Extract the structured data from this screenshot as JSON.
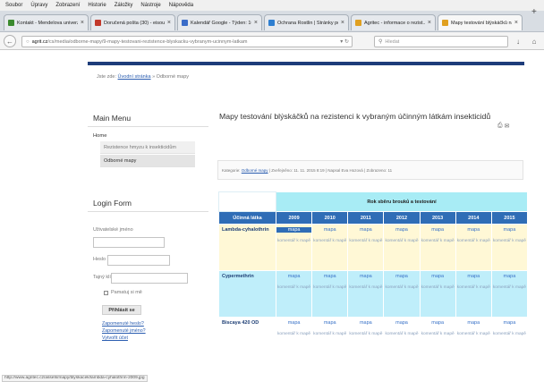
{
  "menubar": [
    "Soubor",
    "Úpravy",
    "Zobrazení",
    "Historie",
    "Záložky",
    "Nástroje",
    "Nápověda"
  ],
  "tabs": [
    {
      "label": "Kontakt - Mendelova univerz...",
      "icon": "green-check-icon",
      "color": "#3b8a2e"
    },
    {
      "label": "Doručená pošta (30) - eisou...",
      "icon": "mail-icon",
      "color": "#c2392b"
    },
    {
      "label": "Kalendář Google - Týden: 16. lis...",
      "icon": "calendar-icon",
      "color": "#3a6cc8"
    },
    {
      "label": "Ochrana Rostlin | Stránky pos...",
      "icon": "page-icon",
      "color": "#2f7fd0"
    },
    {
      "label": "Agritec - informace o rezist...",
      "icon": "agritec-icon",
      "color": "#e0a020"
    },
    {
      "label": "Mapy testování blýskáčků na...",
      "icon": "agritec-icon",
      "color": "#e0a020"
    }
  ],
  "nav": {
    "url_host": "agrit.cz",
    "url_path": "/cs/media/odborne-mapy/9-mapy-testovani-rezistence-blyskacku-vybranym-ucinnym-latkam",
    "search_placeholder": "Hledat"
  },
  "page": {
    "breadcrumb_prefix": "Jste zde:",
    "breadcrumb_home": "Úvodní stránka",
    "breadcrumb_sep": "»",
    "breadcrumb_current": "Odborné mapy",
    "main_menu": {
      "title": "Main Menu",
      "home": "Home",
      "items": [
        {
          "label": "Rezistence hmyzu k insekticidům",
          "active": false
        },
        {
          "label": "Odborné mapy",
          "active": true
        }
      ]
    },
    "login": {
      "title": "Login Form",
      "username_label": "Uživatelské jméno",
      "password_label": "Heslo",
      "secret_label": "Tajný klíč",
      "remember_label": "Pamatuj si mě",
      "submit_label": "Přihlásit se",
      "links": [
        "Zapomenuté heslo?",
        "Zapomenuté jméno?",
        "Vytvořit účet"
      ]
    },
    "article": {
      "title": "Mapy testování blýskáčků na rezistenci k vybraným účinným látkám insekticidů",
      "meta_category_label": "Kategorie:",
      "meta_category": "Odborné mapy",
      "meta_rest": "| Zveřejněno: 11. 11. 2015 8:19 | Napsal Eva Hozová | Zobrazeno: 11"
    },
    "table": {
      "year_header": "Rok sběru brouků a testování",
      "col_label": "Účinná látka",
      "years": [
        "2009",
        "2010",
        "2011",
        "2012",
        "2013",
        "2014",
        "2015"
      ],
      "map_label": "mapa",
      "comment_label": "komentář k mapě",
      "rows": [
        {
          "substance": "Lambda-cyhalothrin",
          "has_comment_first": true
        },
        {
          "substance": "Cypermethrin",
          "has_comment_first": true
        },
        {
          "substance": "Biscaya 420 OD",
          "has_comment_first": true
        }
      ]
    }
  },
  "status": {
    "text": "http://www.agritec.cz/assets/mapy/blyskacek/lambda-cyhalothrin-2009.jpg"
  }
}
